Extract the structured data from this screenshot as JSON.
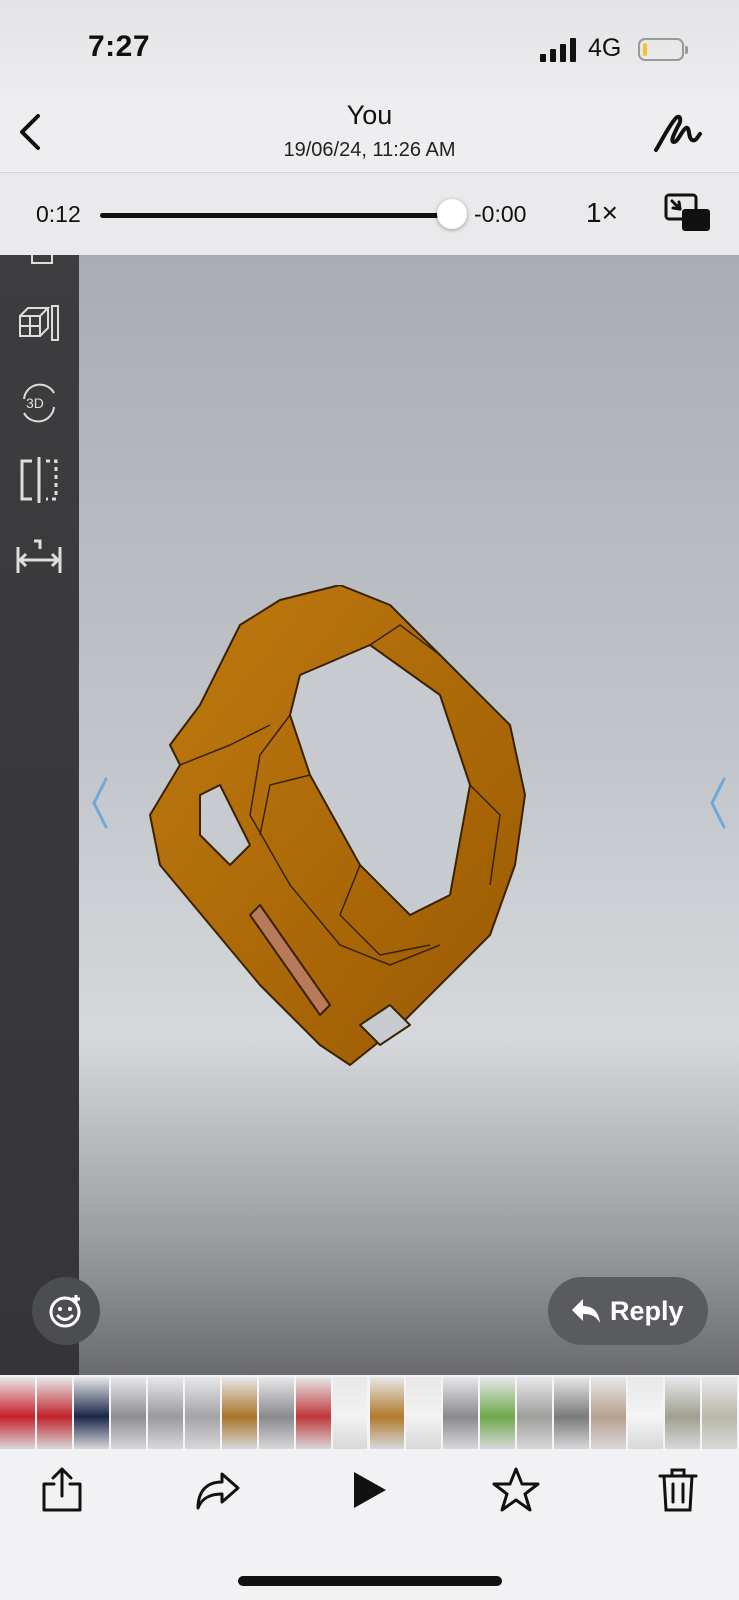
{
  "status_bar": {
    "time": "7:27",
    "network": "4G"
  },
  "header": {
    "title": "You",
    "subtitle": "19/06/24, 11:26 AM"
  },
  "player": {
    "elapsed": "0:12",
    "remaining": "-0:00",
    "progress": 1.0,
    "speed": "1×"
  },
  "viewer": {
    "toolbar_icons": [
      "view-cube-icon",
      "rotate-3d-icon",
      "section-icon",
      "measure-icon"
    ],
    "rotate_label": "3D",
    "model_color": "#b56a06"
  },
  "reactions": {
    "reply_label": "Reply"
  },
  "thumbnail_strip": {
    "count": 20,
    "colors": [
      "#c8202a",
      "#c0242c",
      "#1a2748",
      "#8e8e90",
      "#9a9a9c",
      "#a4a4a6",
      "#a8742a",
      "#8a8a8c",
      "#c0383a",
      "#f2f2f2",
      "#b07a2c",
      "#f2f2f2",
      "#8a8a8c",
      "#6ea84a",
      "#9e9e9c",
      "#7a7a7a",
      "#b8a090",
      "#f4f4f4",
      "#a0a090",
      "#bab8a8"
    ]
  },
  "actions": [
    "share-icon",
    "forward-icon",
    "play-icon",
    "star-icon",
    "trash-icon"
  ]
}
